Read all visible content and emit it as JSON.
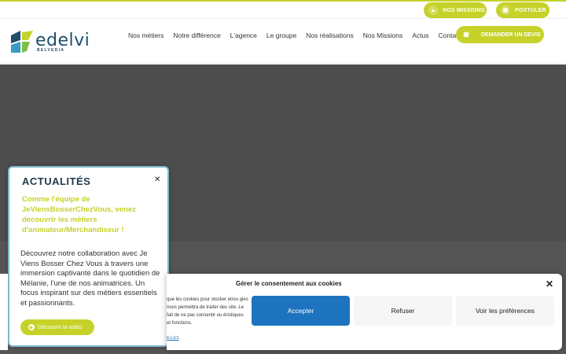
{
  "topbar": {
    "missions_label": "NOS MISSIONS",
    "postuler_label": "POSTULER"
  },
  "logo": {
    "name": "edelvi",
    "sub": "BELVEDIA"
  },
  "nav": [
    "Nos métiers",
    "Notre différence",
    "L'agence",
    "Le groupe",
    "Nos réalisations",
    "Nos Missions",
    "Actus",
    "Contact"
  ],
  "header": {
    "devis_label": "DEMANDER UN DEVIS"
  },
  "actualites": {
    "title": "ACTUALITÉS",
    "headline": " Comme l'équipe de JeViensBosserChezVous, venez découvrir les métiers d'animateur/Merchandiseur !",
    "body": "Découvrez notre collaboration avec Je Viens Bosser Chez Vous à travers une immersion captivante dans le quotidien de Mélanie, l'une de nos animatrices. Un focus inspirant sur des métiers essentiels et passionnants.",
    "button_label": "Découvrir la vidéo"
  },
  "consent": {
    "title": "Gérer le consentement aux cookies",
    "text": "que les cookies pour stocker et/ou gies nous permettra de traiter des site. Le fait de ne pas consentir ou éristiques et fonctions.",
    "link": "ELLES",
    "accept_label": "Accepter",
    "refuse_label": "Refuser",
    "prefs_label": "Voir les préférences"
  },
  "colors": {
    "accent": "#c6d22a",
    "brand": "#1e4d6b",
    "button_blue": "#1e73be"
  }
}
